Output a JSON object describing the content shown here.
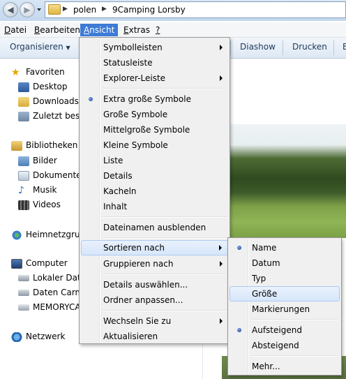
{
  "address": {
    "crumbs": [
      "polen",
      "9Camping Lorsby"
    ]
  },
  "menubar": [
    {
      "label": "Datei",
      "u": "D",
      "rest": "atei"
    },
    {
      "label": "Bearbeiten",
      "u": "B",
      "rest": "earbeiten"
    },
    {
      "label": "Ansicht",
      "u": "A",
      "rest": "nsicht"
    },
    {
      "label": "Extras",
      "u": "E",
      "rest": "xtras"
    },
    {
      "label": "?",
      "u": "?",
      "rest": ""
    }
  ],
  "toolbar": {
    "organize": "Organisieren",
    "slideshow": "Diashow",
    "print": "Drucken",
    "more": "E"
  },
  "nav": {
    "favorites": "Favoriten",
    "desktop": "Desktop",
    "downloads": "Downloads",
    "recent": "Zuletzt besucht",
    "libraries": "Bibliotheken",
    "pictures": "Bilder",
    "documents": "Dokumente",
    "music": "Musik",
    "videos": "Videos",
    "homegroup": "Heimnetzgruppe",
    "computer": "Computer",
    "localdisk": "Lokaler Datenträger",
    "datacarmen": "Daten Carmen",
    "memorycard": "MEMORYCARD",
    "network": "Netzwerk"
  },
  "view_menu": {
    "toolbars": "Symbolleisten",
    "statusbar": "Statusleiste",
    "explorerbar": "Explorer-Leiste",
    "xlarge": "Extra große Symbole",
    "large": "Große Symbole",
    "medium": "Mittelgroße Symbole",
    "small": "Kleine Symbole",
    "list": "Liste",
    "details": "Details",
    "tiles": "Kacheln",
    "content": "Inhalt",
    "hidenames": "Dateinamen ausblenden",
    "sortby": "Sortieren nach",
    "groupby": "Gruppieren nach",
    "choosedetails": "Details auswählen...",
    "customize": "Ordner anpassen...",
    "goto": "Wechseln Sie zu",
    "refresh": "Aktualisieren"
  },
  "sort_menu": {
    "name": "Name",
    "date": "Datum",
    "type": "Typ",
    "size": "Größe",
    "tags": "Markierungen",
    "ascending": "Aufsteigend",
    "descending": "Absteigend",
    "more": "Mehr..."
  }
}
